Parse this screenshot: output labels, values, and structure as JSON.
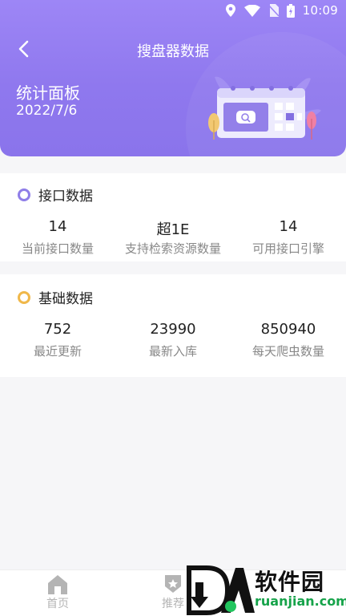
{
  "status_bar": {
    "time": "10:09",
    "icons": [
      "location-icon",
      "wifi-icon",
      "no-sim-icon",
      "battery-icon"
    ]
  },
  "header": {
    "title": "搜盘器数据",
    "panel_title": "统计面板",
    "date": "2022/7/6"
  },
  "sections": [
    {
      "title": "接口数据",
      "ring_color": "#8f7ee8",
      "stats": [
        {
          "value": "14",
          "label": "当前接口数量"
        },
        {
          "value": "超1E",
          "label": "支持检索资源数量"
        },
        {
          "value": "14",
          "label": "可用接口引擎"
        }
      ]
    },
    {
      "title": "基础数据",
      "ring_color": "#f0b84a",
      "stats": [
        {
          "value": "752",
          "label": "最近更新"
        },
        {
          "value": "23990",
          "label": "最新入库"
        },
        {
          "value": "850940",
          "label": "每天爬虫数量"
        }
      ]
    }
  ],
  "bottom_nav": {
    "items": [
      {
        "label": "首页",
        "icon": "home-icon"
      },
      {
        "label": "推荐",
        "icon": "badge-icon"
      }
    ]
  },
  "watermark": {
    "text": "软件园",
    "url": "ruanjian.com"
  },
  "colors": {
    "header_purple": "#9580f1",
    "accent_purple": "#8f7ee8",
    "accent_yellow": "#f0b84a"
  }
}
